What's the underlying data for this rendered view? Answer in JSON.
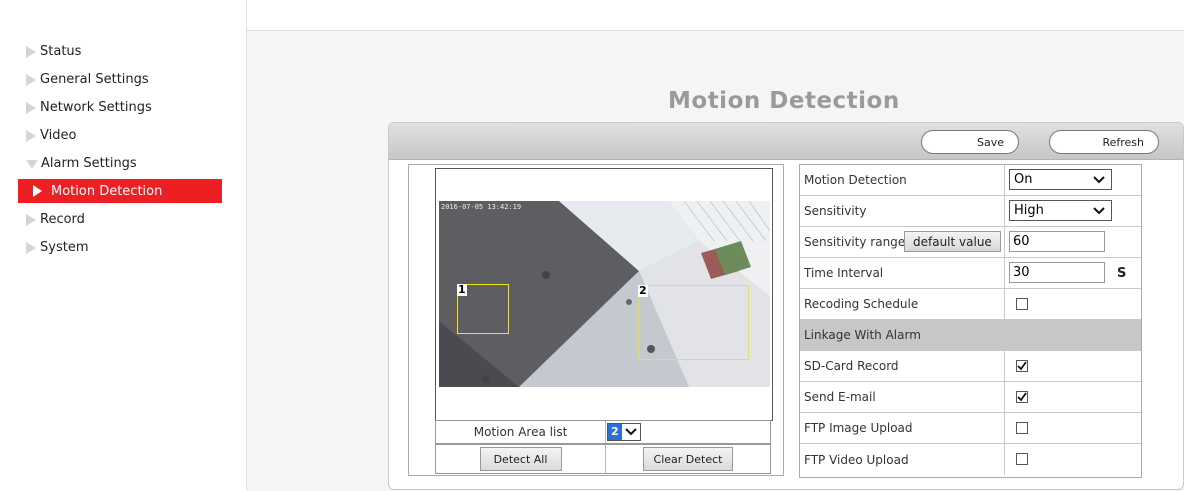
{
  "sidebar": {
    "items": [
      {
        "label": "Status",
        "icon": "triangle-right-icon"
      },
      {
        "label": "General Settings",
        "icon": "triangle-right-icon"
      },
      {
        "label": "Network Settings",
        "icon": "triangle-right-icon"
      },
      {
        "label": "Video",
        "icon": "triangle-right-icon"
      },
      {
        "label": "Alarm Settings",
        "icon": "triangle-down-icon"
      },
      {
        "label": "Motion Detection",
        "icon": "triangle-right-icon",
        "active": true
      },
      {
        "label": "Record",
        "icon": "triangle-right-icon"
      },
      {
        "label": "System",
        "icon": "triangle-right-icon"
      }
    ],
    "active_color": "#ee1f22"
  },
  "page": {
    "title": "Motion Detection"
  },
  "toolbar": {
    "save_label": "Save",
    "refresh_label": "Refresh"
  },
  "video": {
    "timestamp": "2016-07-05 13:42:19",
    "areas": [
      {
        "label": "1"
      },
      {
        "label": "2"
      }
    ],
    "area_color": "#f2e60c"
  },
  "controls": {
    "area_list_label": "Motion Area list",
    "area_list_selected": "2",
    "detect_all_label": "Detect All",
    "clear_detect_label": "Clear Detect"
  },
  "form": {
    "motion_detection": {
      "label": "Motion Detection",
      "value": "On"
    },
    "sensitivity": {
      "label": "Sensitivity",
      "value": "High"
    },
    "sensitivity_range": {
      "label": "Sensitivity range",
      "button": "default value",
      "value": "60"
    },
    "time_interval": {
      "label": "Time Interval",
      "value": "30",
      "unit": "S"
    },
    "recording_schedule": {
      "label": "Recoding Schedule",
      "checked": false
    },
    "linkage_header": "Linkage With Alarm",
    "sd_card_record": {
      "label": "SD-Card Record",
      "checked": true
    },
    "send_email": {
      "label": "Send E-mail",
      "checked": true
    },
    "ftp_image_upload": {
      "label": "FTP Image Upload",
      "checked": false
    },
    "ftp_video_upload": {
      "label": "FTP Video Upload",
      "checked": false
    }
  }
}
